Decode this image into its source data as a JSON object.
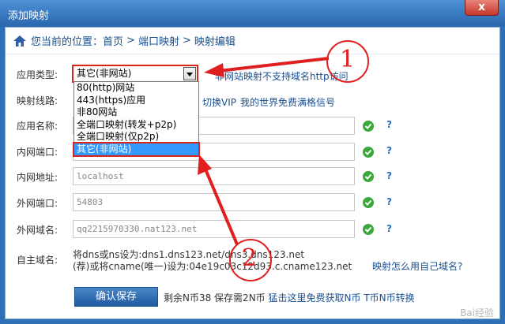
{
  "window": {
    "title": "添加映射",
    "close_label": "x"
  },
  "breadcrumb": {
    "prefix": "您当前的位置：",
    "items": [
      "首页",
      "端口映射",
      "映射编辑"
    ],
    "separator": ">"
  },
  "form": {
    "app_type": {
      "label": "应用类型:",
      "value": "其它(非网站)",
      "options": [
        "80(http)网站",
        "443(https)应用",
        "非80网站",
        "全端口映射(转发+p2p)",
        "全端口映射(仅p2p)",
        "其它(非网站)"
      ],
      "note": "非网站映射不支持域名http访问"
    },
    "line": {
      "label": "映射线路:",
      "link1": "切换VIP",
      "link2": "我的世界免费满格信号"
    },
    "app_name": {
      "label": "应用名称:",
      "value": ""
    },
    "lan_port": {
      "label": "内网端口:",
      "value": ""
    },
    "lan_addr": {
      "label": "内网地址:",
      "value": "localhost"
    },
    "wan_port": {
      "label": "外网端口:",
      "value": "54803"
    },
    "wan_domain": {
      "label": "外网域名:",
      "value": "qq2215970330.nat123.net"
    },
    "custom_domain": {
      "label": "自主域名:",
      "line1": "将dns或ns设为:dns1.dns123.net/dns3.dns123.net",
      "line2": "(荐)或将cname(唯一)设为:04e19c03c12d93.c.cname123.net",
      "help_link": "映射怎么用自己域名?"
    },
    "help_symbol": "?"
  },
  "footer": {
    "save_label": "确认保存",
    "remaining": "剩余N币38 保存需2N币",
    "get_coins": "猛击这里免费获取N币",
    "convert": "T币N币转换"
  },
  "annotations": {
    "marker1": "1",
    "marker2": "2",
    "accent_color": "#e02020"
  },
  "watermark": "Bai经验"
}
